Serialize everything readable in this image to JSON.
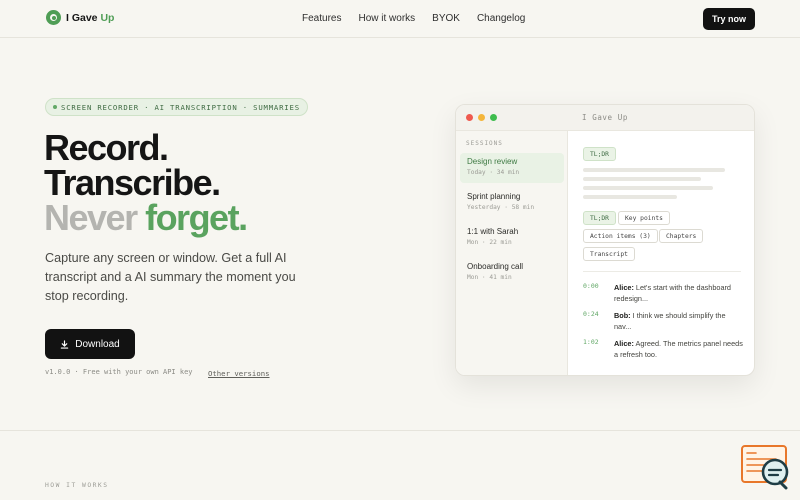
{
  "header": {
    "brand": "I Gave",
    "brand_accent": "Up",
    "nav": [
      "Features",
      "How it works",
      "BYOK",
      "Changelog"
    ],
    "cta": "Try now"
  },
  "hero": {
    "badge": "SCREEN RECORDER · AI TRANSCRIPTION · SUMMARIES",
    "line1": "Record.",
    "line2": "Transcribe.",
    "line3_a": "Never ",
    "line3_b": "forget.",
    "subtitle": "Capture any screen or window. Get a full AI transcript and a AI summary the moment you stop recording.",
    "download": "Download",
    "version": "v1.0.0 · Free with your own API key",
    "other_versions": "Other versions"
  },
  "app_window": {
    "title": "I Gave Up",
    "sessions_label": "SESSIONS",
    "sessions": [
      {
        "name": "Design review",
        "meta": "Today · 34 min"
      },
      {
        "name": "Sprint planning",
        "meta": "Yesterday · 58 min"
      },
      {
        "name": "1:1 with Sarah",
        "meta": "Mon · 22 min"
      },
      {
        "name": "Onboarding call",
        "meta": "Mon · 41 min"
      }
    ],
    "tldr": "TL;DR",
    "tabs": [
      "TL;DR",
      "Key points",
      "Action items (3)",
      "Chapters",
      "Transcript"
    ],
    "transcript": [
      {
        "time": "0:00",
        "speaker": "Alice:",
        "text": " Let's start with the dashboard redesign..."
      },
      {
        "time": "0:24",
        "speaker": "Bob:",
        "text": " I think we should simplify the nav..."
      },
      {
        "time": "1:02",
        "speaker": "Alice:",
        "text": " Agreed. The metrics panel needs a refresh too."
      }
    ]
  },
  "section": {
    "label": "HOW IT WORKS"
  }
}
